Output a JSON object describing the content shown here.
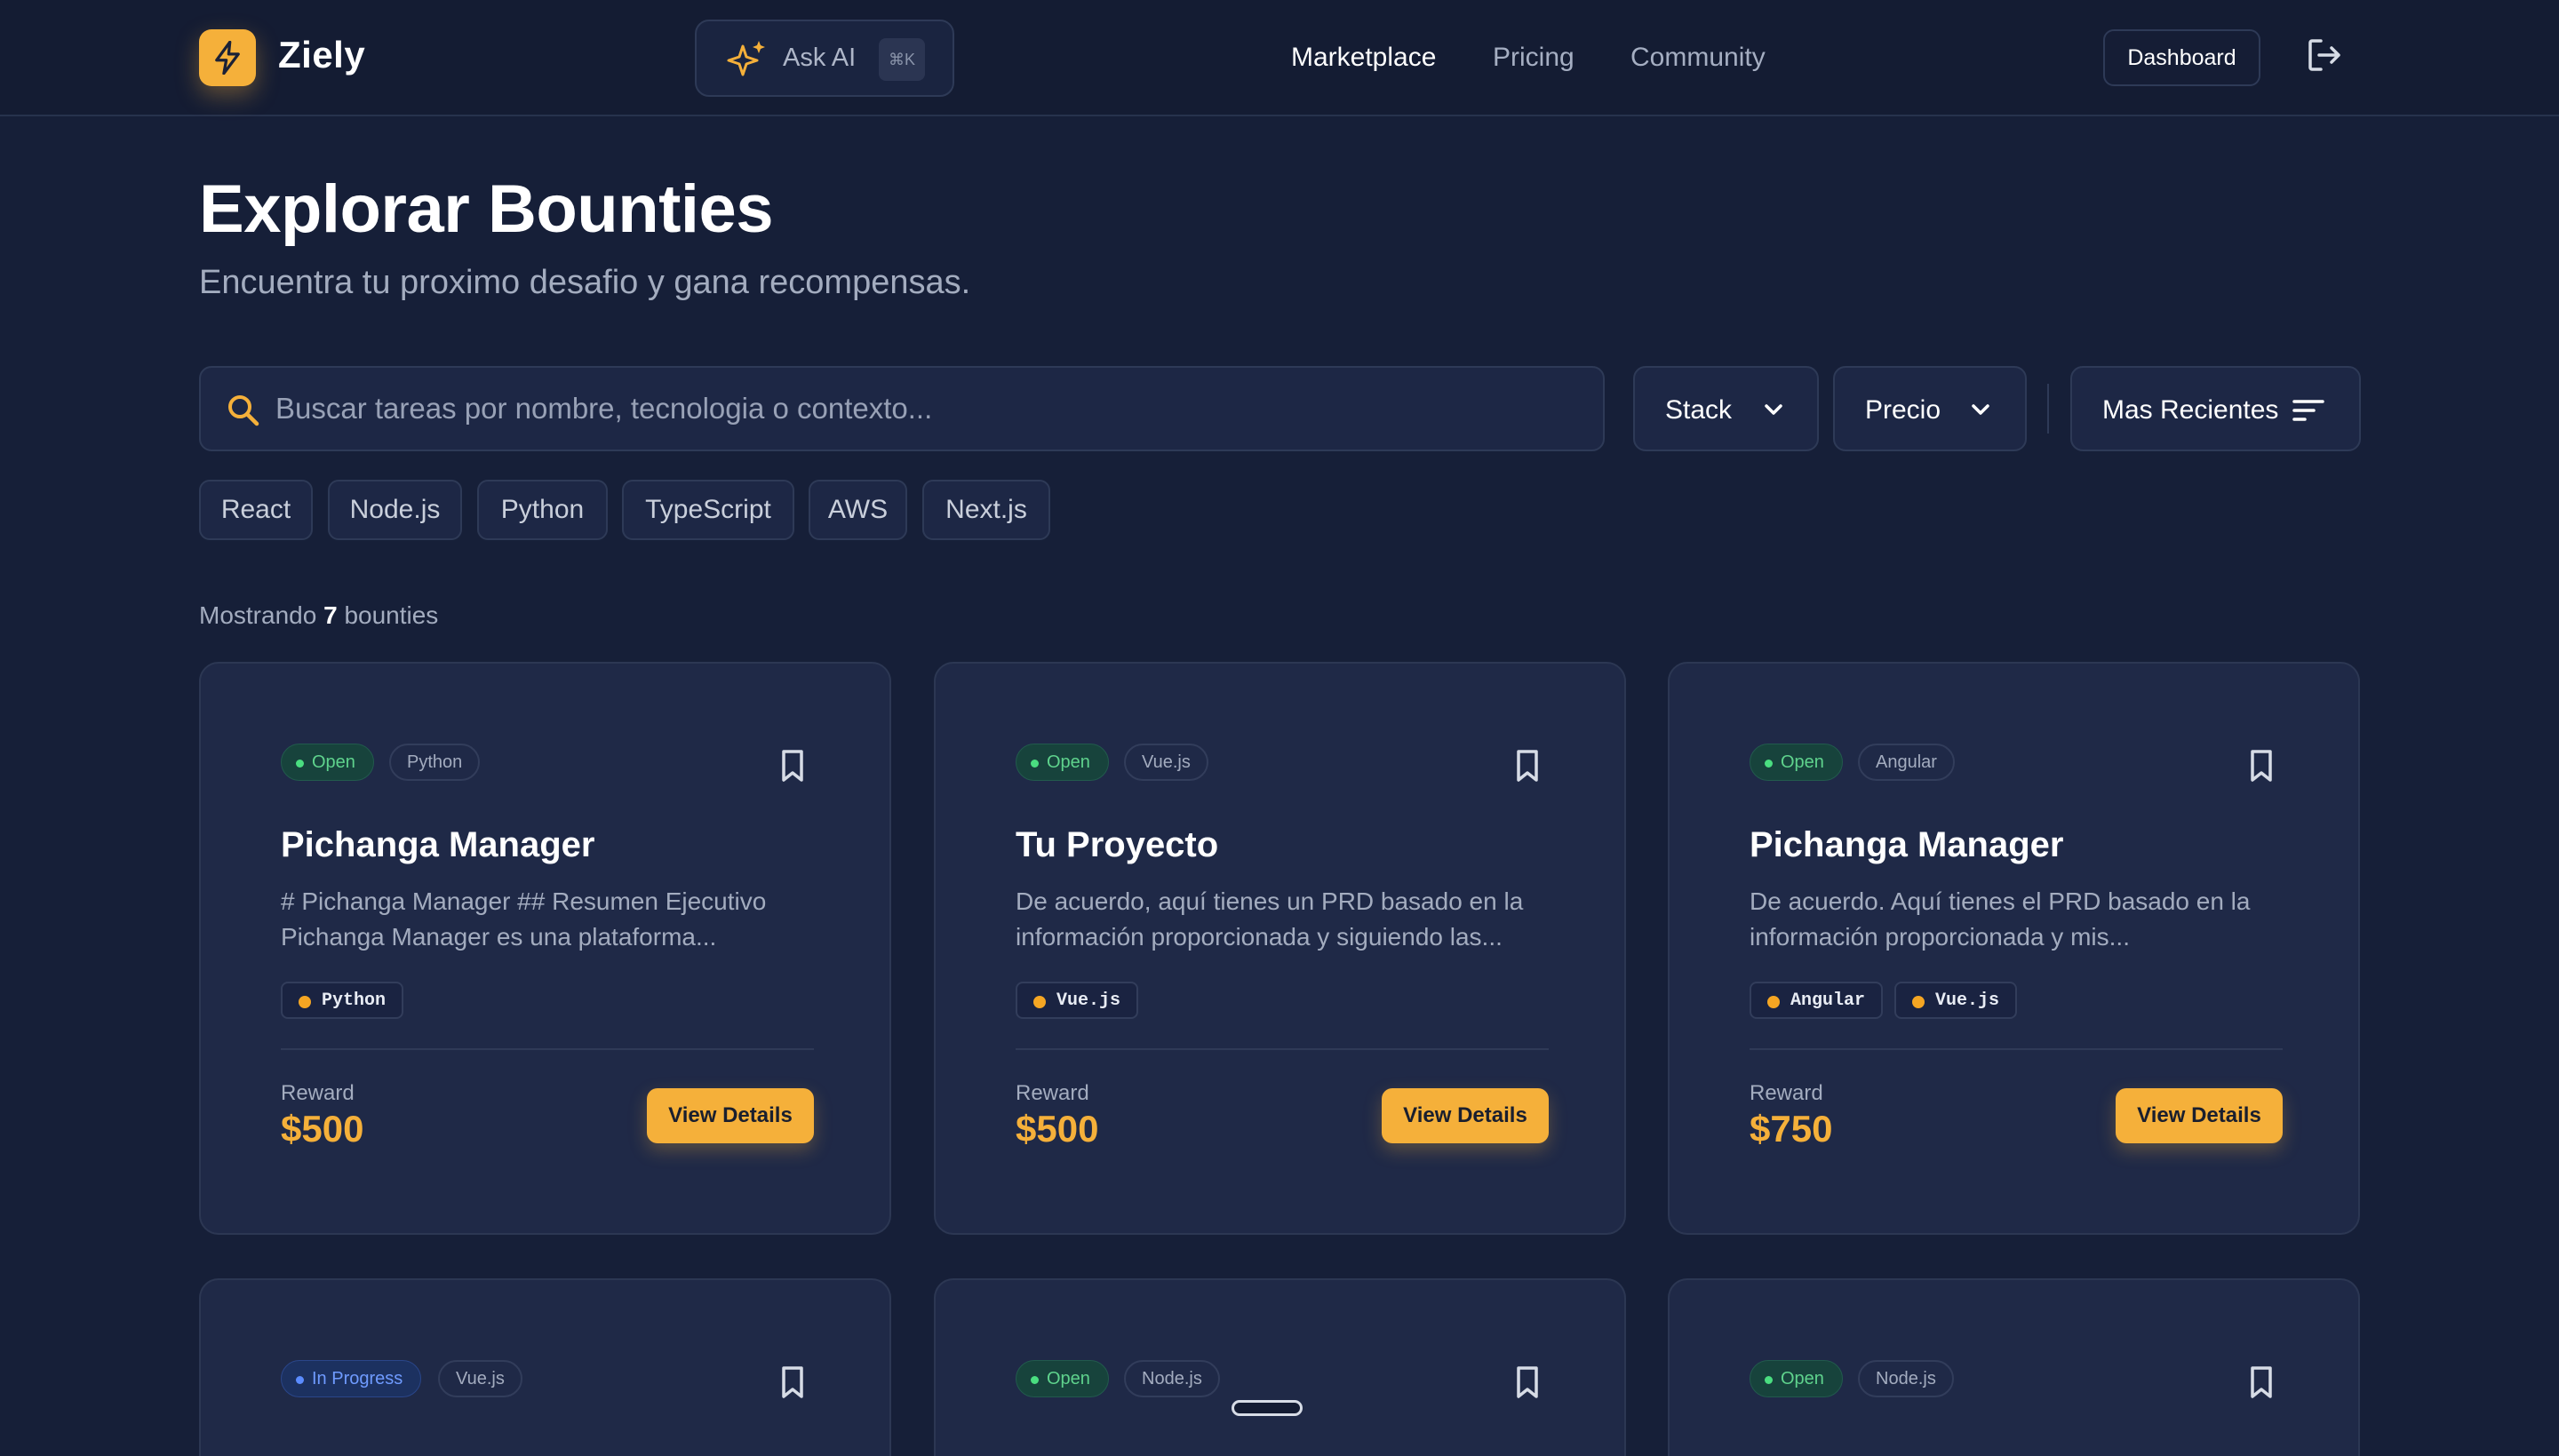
{
  "header": {
    "brand": "Ziely",
    "ask_ai": {
      "label": "Ask AI",
      "shortcut": "⌘K"
    },
    "nav": [
      {
        "label": "Marketplace",
        "active": true
      },
      {
        "label": "Pricing",
        "active": false
      },
      {
        "label": "Community",
        "active": false
      }
    ],
    "dashboard_label": "Dashboard"
  },
  "page": {
    "title": "Explorar Bounties",
    "subtitle": "Encuentra tu proximo desafio y gana recompensas."
  },
  "search": {
    "placeholder": "Buscar tareas por nombre, tecnologia o contexto...",
    "value": ""
  },
  "filters": {
    "stack": "Stack",
    "price": "Precio",
    "sort": "Mas Recientes"
  },
  "chips": [
    "React",
    "Node.js",
    "Python",
    "TypeScript",
    "AWS",
    "Next.js"
  ],
  "results": {
    "prefix": "Mostrando",
    "count": "7",
    "suffix": "bounties"
  },
  "cards": [
    {
      "status": "Open",
      "tech": "Python",
      "title": "Pichanga Manager",
      "description": "# Pichanga Manager ## Resumen Ejecutivo\nPichanga Manager es una plataforma...",
      "skills": [
        "Python"
      ],
      "reward_label": "Reward",
      "reward": "$500",
      "cta": "View Details"
    },
    {
      "status": "Open",
      "tech": "Vue.js",
      "title": "Tu Proyecto",
      "description": "De acuerdo, aquí tienes un PRD basado en la\ninformación proporcionada y siguiendo las...",
      "skills": [
        "Vue.js"
      ],
      "reward_label": "Reward",
      "reward": "$500",
      "cta": "View Details"
    },
    {
      "status": "Open",
      "tech": "Angular",
      "title": "Pichanga Manager",
      "description": "De acuerdo. Aquí tienes el PRD basado en la\ninformación proporcionada y mis...",
      "skills": [
        "Angular",
        "Vue.js"
      ],
      "reward_label": "Reward",
      "reward": "$750",
      "cta": "View Details"
    },
    {
      "status": "In Progress",
      "tech": "Vue.js"
    },
    {
      "status": "Open",
      "tech": "Node.js"
    },
    {
      "status": "Open",
      "tech": "Node.js"
    }
  ],
  "colors": {
    "accent": "#f5b03a",
    "background": "#161f38",
    "card": "#1f2947",
    "open": "#4ade80",
    "in_progress": "#5b8cff"
  },
  "icons": {
    "logo": "lightning-icon",
    "ask_ai": "sparkle-icon",
    "logout": "logout-icon",
    "search": "search-icon",
    "dropdown": "chevron-down-icon",
    "sort": "sort-lines-icon",
    "bookmark": "bookmark-icon"
  }
}
